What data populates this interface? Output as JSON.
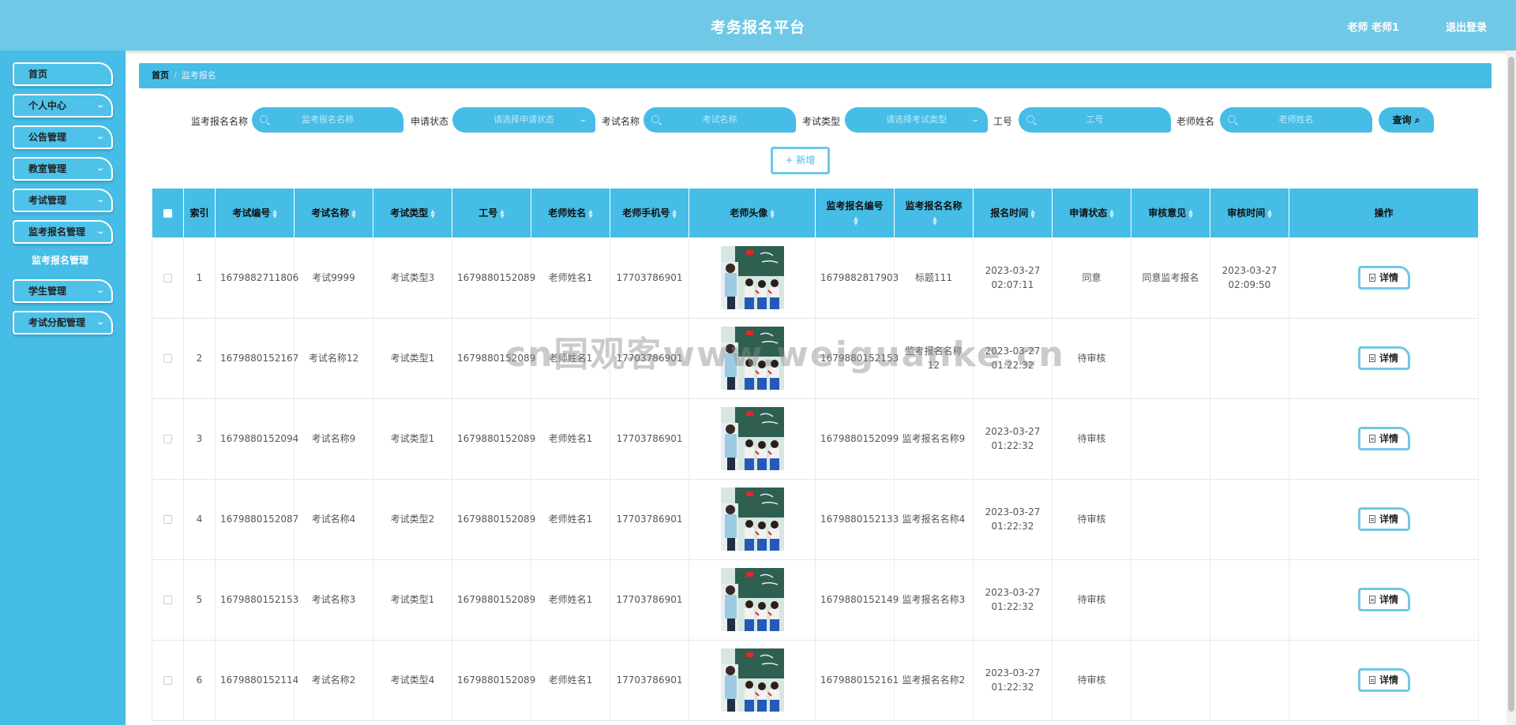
{
  "header": {
    "title": "考务报名平台",
    "user": "老师 老师1",
    "logout": "退出登录"
  },
  "sidebar": {
    "items": [
      {
        "label": "首页"
      },
      {
        "label": "个人中心"
      },
      {
        "label": "公告管理"
      },
      {
        "label": "教室管理"
      },
      {
        "label": "考试管理"
      },
      {
        "label": "监考报名管理"
      },
      {
        "label": "学生管理"
      },
      {
        "label": "考试分配管理"
      }
    ],
    "submenu": {
      "label": "监考报名管理"
    }
  },
  "breadcrumb": {
    "home": "首页",
    "separator": "/",
    "current": "监考报名"
  },
  "search": {
    "fields": [
      {
        "label": "监考报名名称",
        "placeholder": "监考报名名称"
      },
      {
        "label": "申请状态",
        "placeholder": "请选择申请状态"
      },
      {
        "label": "考试名称",
        "placeholder": "考试名称"
      },
      {
        "label": "考试类型",
        "placeholder": "请选择考试类型"
      },
      {
        "label": "工号",
        "placeholder": "工号"
      },
      {
        "label": "老师姓名",
        "placeholder": "老师姓名"
      }
    ],
    "query_label": "查询",
    "add_label": "+ 新增"
  },
  "table": {
    "columns": [
      "索引",
      "考试编号",
      "考试名称",
      "考试类型",
      "工号",
      "老师姓名",
      "老师手机号",
      "老师头像",
      "监考报名编号",
      "监考报名名称",
      "报名时间",
      "申请状态",
      "审核意见",
      "审核时间",
      "操作"
    ],
    "action_label": "详情",
    "rows": [
      {
        "index": "1",
        "exam_no": "1679882711806",
        "exam_name": "考试9999",
        "exam_type": "考试类型3",
        "job_no": "1679880152089",
        "teacher": "老师姓名1",
        "phone": "17703786901",
        "reg_no": "1679882817903",
        "reg_name": "标题111",
        "reg_time": "2023-03-27 02:07:11",
        "status": "同意",
        "opinion": "同意监考报名",
        "review_time": "2023-03-27 02:09:50"
      },
      {
        "index": "2",
        "exam_no": "1679880152167",
        "exam_name": "考试名称12",
        "exam_type": "考试类型1",
        "job_no": "1679880152089",
        "teacher": "老师姓名1",
        "phone": "17703786901",
        "reg_no": "1679880152153",
        "reg_name": "监考报名名称12",
        "reg_time": "2023-03-27 01:22:32",
        "status": "待审核",
        "opinion": "",
        "review_time": ""
      },
      {
        "index": "3",
        "exam_no": "1679880152094",
        "exam_name": "考试名称9",
        "exam_type": "考试类型1",
        "job_no": "1679880152089",
        "teacher": "老师姓名1",
        "phone": "17703786901",
        "reg_no": "1679880152099",
        "reg_name": "监考报名名称9",
        "reg_time": "2023-03-27 01:22:32",
        "status": "待审核",
        "opinion": "",
        "review_time": ""
      },
      {
        "index": "4",
        "exam_no": "1679880152087",
        "exam_name": "考试名称4",
        "exam_type": "考试类型2",
        "job_no": "1679880152089",
        "teacher": "老师姓名1",
        "phone": "17703786901",
        "reg_no": "1679880152133",
        "reg_name": "监考报名名称4",
        "reg_time": "2023-03-27 01:22:32",
        "status": "待审核",
        "opinion": "",
        "review_time": ""
      },
      {
        "index": "5",
        "exam_no": "1679880152153",
        "exam_name": "考试名称3",
        "exam_type": "考试类型1",
        "job_no": "1679880152089",
        "teacher": "老师姓名1",
        "phone": "17703786901",
        "reg_no": "1679880152149",
        "reg_name": "监考报名名称3",
        "reg_time": "2023-03-27 01:22:32",
        "status": "待审核",
        "opinion": "",
        "review_time": ""
      },
      {
        "index": "6",
        "exam_no": "1679880152114",
        "exam_name": "考试名称2",
        "exam_type": "考试类型4",
        "job_no": "1679880152089",
        "teacher": "老师姓名1",
        "phone": "17703786901",
        "reg_no": "1679880152161",
        "reg_name": "监考报名名称2",
        "reg_time": "2023-03-27 01:22:32",
        "status": "待审核",
        "opinion": "",
        "review_time": ""
      }
    ]
  },
  "watermark": "cn国观客www.weiguanke.cn",
  "colors": {
    "header": "#6fc8e6",
    "sidebar": "#45bde7",
    "accent": "#45bde7",
    "button_border": "#6fc8e6"
  }
}
